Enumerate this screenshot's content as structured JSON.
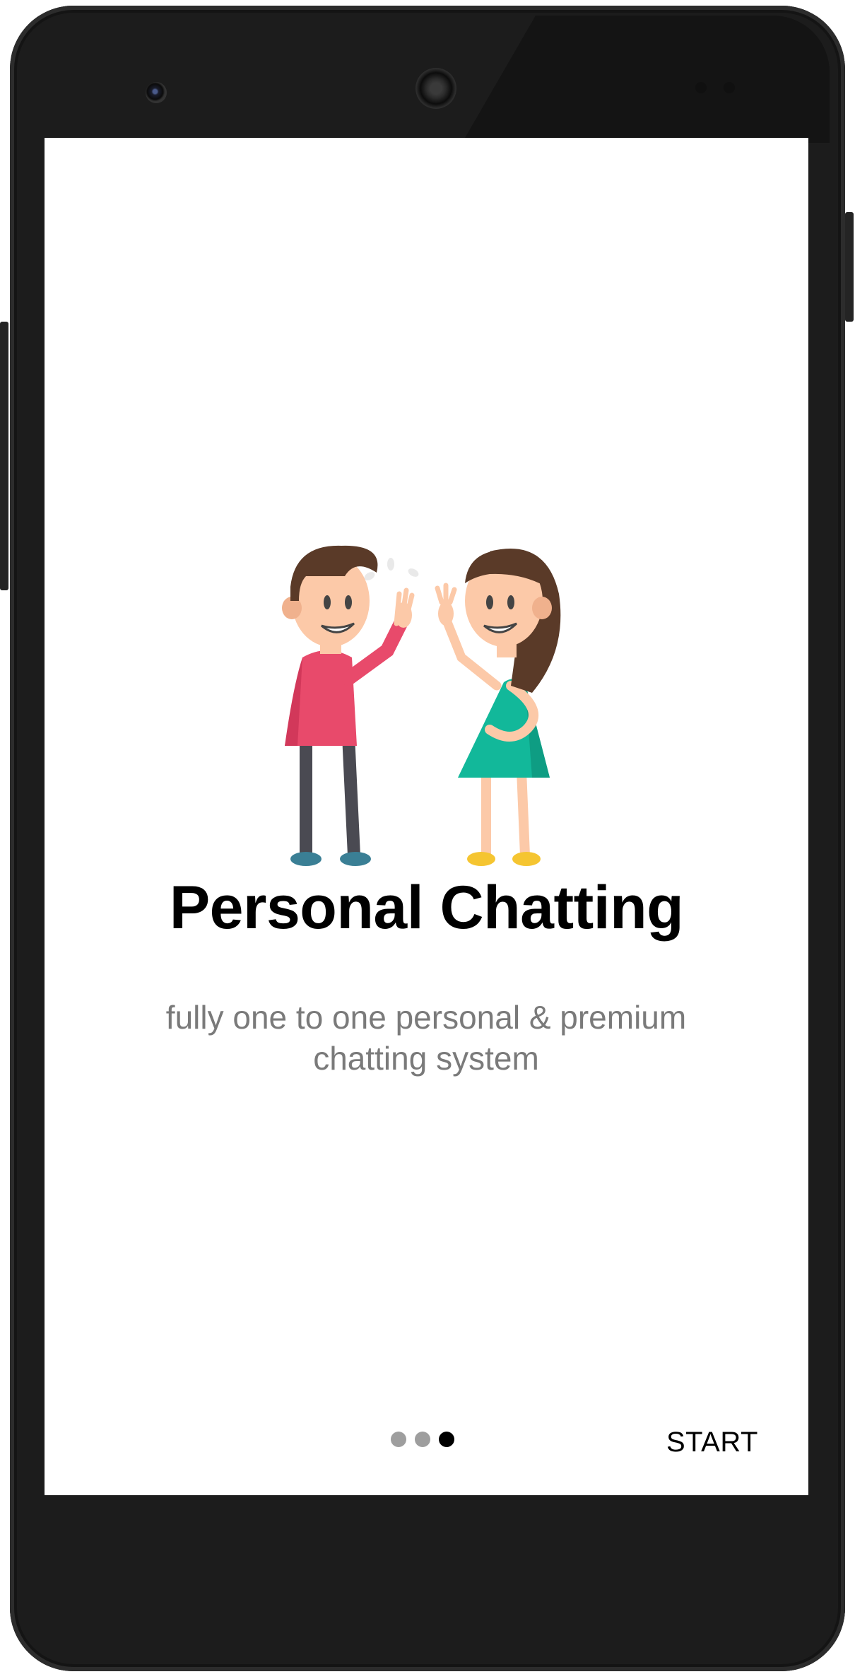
{
  "onboarding": {
    "title": "Personal Chatting",
    "subtitle": "fully one to one personal & premium chatting system",
    "illustration_icon": "high-five-couple-icon",
    "page_indicator": {
      "total": 3,
      "current": 3
    },
    "start_label": "START"
  },
  "colors": {
    "title": "#000000",
    "subtitle": "#7a7a7a",
    "dot_inactive": "#9e9e9e",
    "dot_active": "#000000",
    "boy_shirt": "#e84a6b",
    "girl_dress": "#12b89a",
    "hair": "#5a3a28"
  }
}
